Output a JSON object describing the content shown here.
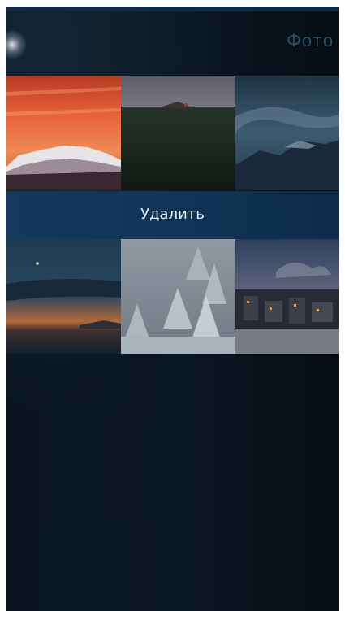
{
  "header": {
    "title": "Фото"
  },
  "context_menu": {
    "delete_label": "Удалить"
  },
  "photos": [
    "sunset-mountain",
    "dark-meadow",
    "cloudy-ridge",
    "dusk-lake",
    "foggy-snowy-forest",
    "city-at-dusk"
  ]
}
